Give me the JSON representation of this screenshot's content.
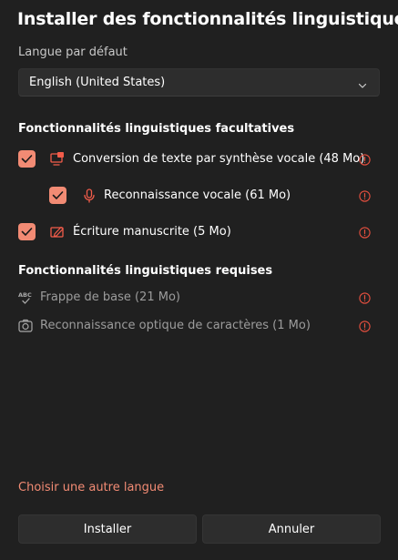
{
  "dialog": {
    "title": "Installer des fonctionnalités linguistiques"
  },
  "default_language": {
    "label": "Langue par défaut",
    "selected": "English (United States)"
  },
  "optional_section": {
    "heading": "Fonctionnalités linguistiques facultatives",
    "items": [
      {
        "label": "Conversion de texte par synthèse vocale (48 Mo)",
        "checked": true,
        "icon": "tts-icon"
      },
      {
        "label": "Reconnaissance vocale (61 Mo)",
        "checked": true,
        "icon": "microphone-icon"
      },
      {
        "label": "Écriture manuscrite (5 Mo)",
        "checked": true,
        "icon": "handwriting-icon"
      }
    ]
  },
  "required_section": {
    "heading": "Fonctionnalités linguistiques requises",
    "items": [
      {
        "label": "Frappe de base (21 Mo)",
        "icon": "spellcheck-icon"
      },
      {
        "label": "Reconnaissance optique de caractères (1 Mo)",
        "icon": "ocr-icon"
      }
    ]
  },
  "footer": {
    "link": "Choisir une autre langue",
    "install_button": "Installer",
    "cancel_button": "Annuler"
  },
  "colors": {
    "background": "#202020",
    "accent": "#f28b74",
    "control": "#2d2d2d",
    "dim_text": "#9c9c9c"
  }
}
